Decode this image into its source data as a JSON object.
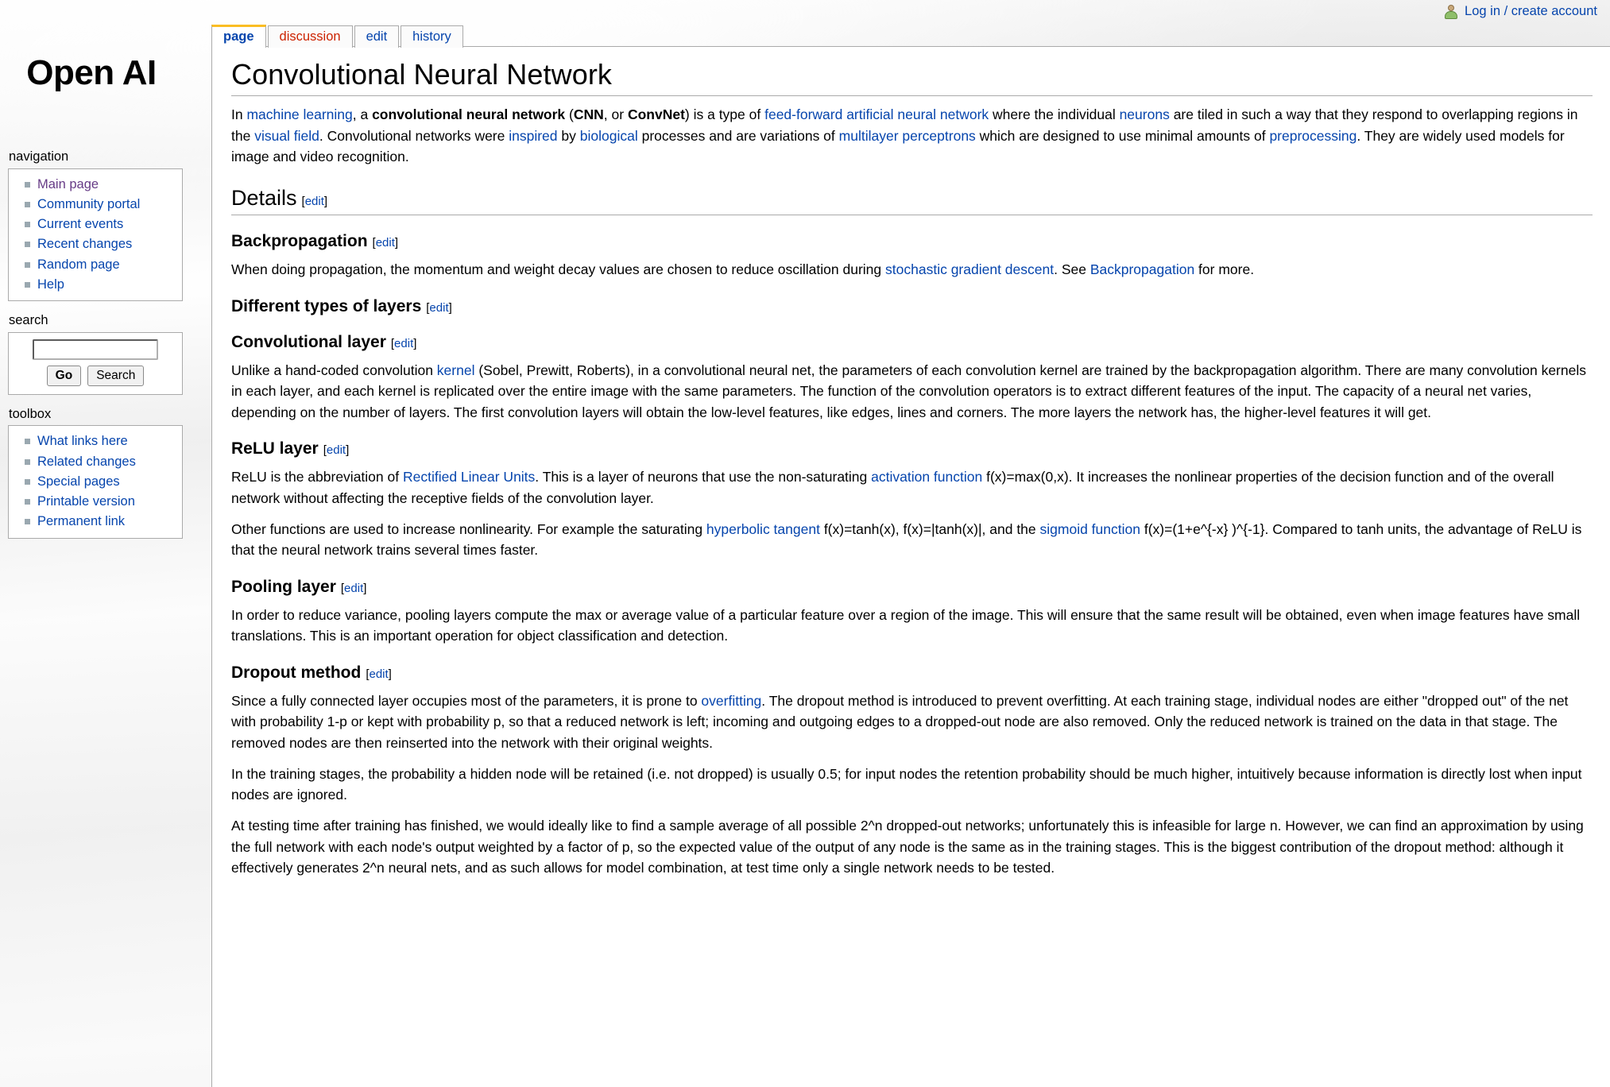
{
  "personal": {
    "login_label": "Log in / create account",
    "user_icon": "user-icon"
  },
  "tabs": [
    {
      "label": "page",
      "state": "selected"
    },
    {
      "label": "discussion",
      "state": "new"
    },
    {
      "label": "edit",
      "state": "normal"
    },
    {
      "label": "history",
      "state": "normal"
    }
  ],
  "logo": {
    "text": "Open AI"
  },
  "sidebar": {
    "navigation": {
      "heading": "navigation",
      "items": [
        {
          "label": "Main page",
          "visited": true
        },
        {
          "label": "Community portal",
          "visited": false
        },
        {
          "label": "Current events",
          "visited": false
        },
        {
          "label": "Recent changes",
          "visited": false
        },
        {
          "label": "Random page",
          "visited": false
        },
        {
          "label": "Help",
          "visited": false
        }
      ]
    },
    "search": {
      "heading": "search",
      "input_value": "",
      "input_placeholder": "",
      "go_label": "Go",
      "search_label": "Search"
    },
    "toolbox": {
      "heading": "toolbox",
      "items": [
        {
          "label": "What links here",
          "visited": false
        },
        {
          "label": "Related changes",
          "visited": false
        },
        {
          "label": "Special pages",
          "visited": false
        },
        {
          "label": "Printable version",
          "visited": false
        },
        {
          "label": "Permanent link",
          "visited": false
        }
      ]
    }
  },
  "article": {
    "title": "Convolutional Neural Network",
    "edit_label": "edit",
    "intro": {
      "p1_a": "In ",
      "link_machine_learning": "machine learning",
      "p1_b": ", a ",
      "bold_cnn_full": "convolutional neural network",
      "p1_c": " (",
      "bold_cnn": "CNN",
      "p1_d": ", or ",
      "bold_convnet": "ConvNet",
      "p1_e": ") is a type of ",
      "link_feedforward": "feed-forward artificial neural network",
      "p1_f": " where the individual ",
      "link_neurons": "neurons",
      "p1_g": " are tiled in such a way that they respond to overlapping regions in the ",
      "link_visual_field": "visual field",
      "p1_h": ". Convolutional networks were ",
      "link_inspired": "inspired",
      "p1_i": " by ",
      "link_biological": "biological",
      "p1_j": " processes and are variations of ",
      "link_multilayer_perceptrons": "multilayer perceptrons",
      "p1_k": " which are designed to use minimal amounts of ",
      "link_preprocessing": "preprocessing",
      "p1_l": ". They are widely used models for image and video recognition."
    },
    "sections": {
      "details": {
        "heading": "Details"
      },
      "backpropagation": {
        "heading": "Backpropagation",
        "p1_a": "When doing propagation, the momentum and weight decay values are chosen to reduce oscillation during ",
        "link_sgd": "stochastic gradient descent",
        "p1_b": ". See ",
        "link_backprop": "Backpropagation",
        "p1_c": " for more."
      },
      "layer_types": {
        "heading": "Different types of layers"
      },
      "convolutional_layer": {
        "heading": "Convolutional layer",
        "p1_a": "Unlike a hand-coded convolution ",
        "link_kernel": "kernel",
        "p1_b": " (Sobel, Prewitt, Roberts), in a convolutional neural net, the parameters of each convolution kernel are trained by the backpropagation algorithm. There are many convolution kernels in each layer, and each kernel is replicated over the entire image with the same parameters. The function of the convolution operators is to extract different features of the input. The capacity of a neural net varies, depending on the number of layers. The first convolution layers will obtain the low-level features, like edges, lines and corners. The more layers the network has, the higher-level features it will get."
      },
      "relu_layer": {
        "heading": "ReLU layer",
        "p1_a": "ReLU is the abbreviation of ",
        "link_rectified": "Rectified Linear Units",
        "p1_b": ". This is a layer of neurons that use the non-saturating ",
        "link_activation": "activation function",
        "p1_c": " f(x)=max(0,x). It increases the nonlinear properties of the decision function and of the overall network without affecting the receptive fields of the convolution layer.",
        "p2_a": "Other functions are used to increase nonlinearity. For example the saturating ",
        "link_tanh": "hyperbolic tangent",
        "p2_b": " f(x)=tanh(x), f(x)=|tanh(x)|, and the ",
        "link_sigmoid": "sigmoid function",
        "p2_c": " f(x)=(1+e^{-x} )^{-1}. Compared to tanh units, the advantage of ReLU is that the neural network trains several times faster."
      },
      "pooling_layer": {
        "heading": "Pooling layer",
        "p1": "In order to reduce variance, pooling layers compute the max or average value of a particular feature over a region of the image. This will ensure that the same result will be obtained, even when image features have small translations. This is an important operation for object classification and detection."
      },
      "dropout_method": {
        "heading": "Dropout method",
        "p1_a": "Since a fully connected layer occupies most of the parameters, it is prone to ",
        "link_overfitting": "overfitting",
        "p1_b": ". The dropout method is introduced to prevent overfitting. At each training stage, individual nodes are either \"dropped out\" of the net with probability 1-p or kept with probability p, so that a reduced network is left; incoming and outgoing edges to a dropped-out node are also removed. Only the reduced network is trained on the data in that stage. The removed nodes are then reinserted into the network with their original weights.",
        "p2": "In the training stages, the probability a hidden node will be retained (i.e. not dropped) is usually 0.5; for input nodes the retention probability should be much higher, intuitively because information is directly lost when input nodes are ignored.",
        "p3": "At testing time after training has finished, we would ideally like to find a sample average of all possible 2^n dropped-out networks; unfortunately this is infeasible for large n. However, we can find an approximation by using the full network with each node's output weighted by a factor of p, so the expected value of the output of any node is the same as in the training stages. This is the biggest contribution of the dropout method: although it effectively generates 2^n neural nets, and as such allows for model combination, at test time only a single network needs to be tested."
      }
    }
  },
  "colors": {
    "link": "#0645ad",
    "link_visited": "#663b86",
    "link_new": "#cc2200",
    "tab_active_border": "#fabd23",
    "border": "#aaaaaa",
    "bullet": "#9aa8b0"
  }
}
